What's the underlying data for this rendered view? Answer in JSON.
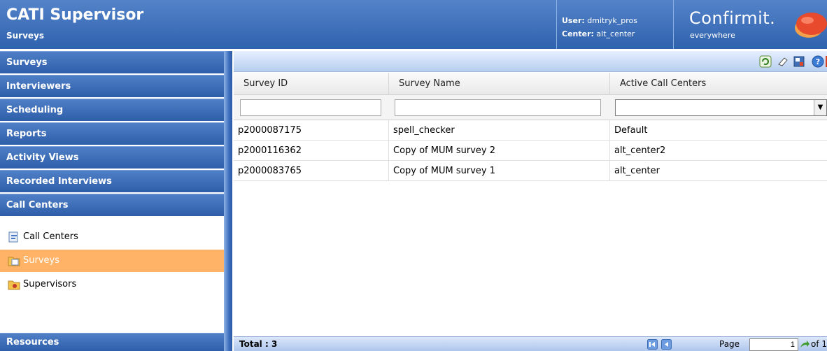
{
  "header": {
    "title": "CATI Supervisor",
    "subtitle": "Surveys",
    "user_label": "User:",
    "user_value": "dmitryk_pros",
    "center_label": "Center:",
    "center_value": "alt_center",
    "logo_text": "Confirmit.",
    "logo_tagline": "everywhere"
  },
  "sidebar": {
    "sections": [
      {
        "label": "Surveys"
      },
      {
        "label": "Interviewers"
      },
      {
        "label": "Scheduling"
      },
      {
        "label": "Reports"
      },
      {
        "label": "Activity Views"
      },
      {
        "label": "Recorded Interviews"
      },
      {
        "label": "Call Centers"
      }
    ],
    "call_center_items": [
      {
        "label": "Call Centers",
        "icon": "call-centers-icon",
        "selected": false
      },
      {
        "label": "Surveys",
        "icon": "surveys-folder-icon",
        "selected": true
      },
      {
        "label": "Supervisors",
        "icon": "supervisors-folder-icon",
        "selected": false
      }
    ],
    "bottom_section": {
      "label": "Resources"
    }
  },
  "toolbar": {
    "icons": [
      "refresh-icon",
      "eraser-icon",
      "export-icon",
      "help-icon",
      "close-icon"
    ]
  },
  "grid": {
    "columns": [
      "Survey ID",
      "Survey Name",
      "Active Call Centers"
    ],
    "rows": [
      {
        "survey_id": "p2000087175",
        "survey_name": "spell_checker",
        "active_call_centers": "Default"
      },
      {
        "survey_id": "p2000116362",
        "survey_name": "Copy of MUM survey 2",
        "active_call_centers": "alt_center2"
      },
      {
        "survey_id": "p2000083765",
        "survey_name": "Copy of MUM survey 1",
        "active_call_centers": "alt_center"
      }
    ]
  },
  "footer": {
    "total_label": "Total : 3",
    "page_label": "Page",
    "page_value": "1",
    "of_label": "of 1"
  },
  "colors": {
    "header_blue": "#2f62ad",
    "selected_orange": "#ffb366"
  }
}
